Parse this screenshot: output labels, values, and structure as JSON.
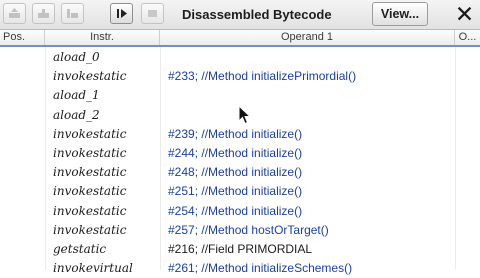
{
  "toolbar": {
    "title": "Disassembled Bytecode",
    "view_button": "View...",
    "close_glyph": "✕",
    "icons": [
      "step-back-icon",
      "step-over-icon",
      "step-out-icon",
      "resume-icon",
      "stop-icon"
    ]
  },
  "table": {
    "columns": [
      "Pos.",
      "Instr.",
      "Operand 1",
      "O..."
    ],
    "rows": [
      {
        "instr": "aload_0",
        "operand": ""
      },
      {
        "instr": "invokestatic",
        "operand": "#233; //Method initializePrimordial()"
      },
      {
        "instr": "aload_1",
        "operand": ""
      },
      {
        "instr": "aload_2",
        "operand": ""
      },
      {
        "instr": "invokestatic",
        "operand": "#239; //Method initialize()"
      },
      {
        "instr": "invokestatic",
        "operand": "#244; //Method initialize()"
      },
      {
        "instr": "invokestatic",
        "operand": "#248; //Method initialize()"
      },
      {
        "instr": "invokestatic",
        "operand": "#251; //Method initialize()"
      },
      {
        "instr": "invokestatic",
        "operand": "#254; //Method initialize()"
      },
      {
        "instr": "invokestatic",
        "operand": "#257; //Method hostOrTarget()"
      },
      {
        "instr": "getstatic",
        "operand": "#216; //Field PRIMORDIAL"
      },
      {
        "instr": "invokevirtual",
        "operand": "#261; //Method initializeSchemes()"
      }
    ]
  },
  "colors": {
    "operand_link": "#1a3fa6",
    "header_underline": "#6f8fd0"
  }
}
